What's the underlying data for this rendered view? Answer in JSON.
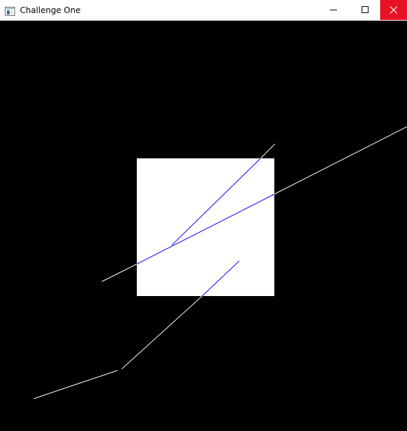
{
  "window": {
    "title": "Challenge One",
    "icon": "app-window-icon",
    "controls": {
      "minimize_icon": "minimize-icon",
      "maximize_icon": "maximize-icon",
      "close_icon": "close-icon",
      "close_color": "#e81123"
    }
  },
  "scene": {
    "background": "#000000",
    "square_color": "#ffffff",
    "line_colors": {
      "outside": "#ffffff",
      "inside_square": "#0000ff"
    }
  }
}
